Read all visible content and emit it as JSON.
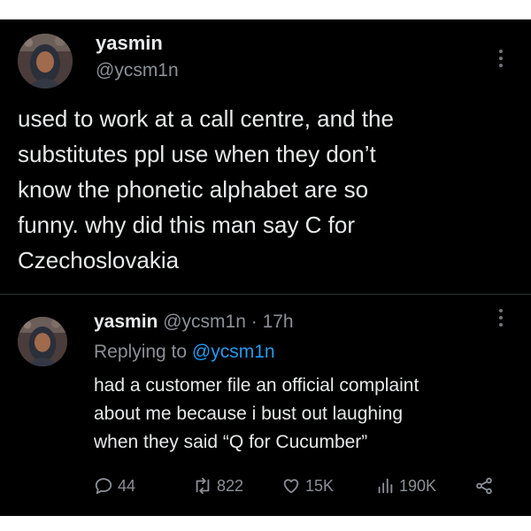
{
  "tweet": {
    "name": "yasmin",
    "handle": "@ycsm1n",
    "text": "used to work at a call centre, and the\nsubstitutes ppl use when they don’t\nknow the phonetic alphabet are so\nfunny. why did this man say C for\nCzechoslovakia"
  },
  "reply": {
    "name": "yasmin",
    "handle": "@ycsm1n",
    "separator": "·",
    "time": "17h",
    "replying_to_label": "Replying to",
    "replying_to_handle": "@ycsm1n",
    "text": "had a customer file an official complaint\nabout me because i bust out laughing\nwhen they said “Q for Cucumber”",
    "stats": {
      "replies": "44",
      "retweets": "822",
      "likes": "15K",
      "views": "190K"
    }
  },
  "icons": [
    "more-icon",
    "reply-icon",
    "retweet-icon",
    "like-icon",
    "views-icon",
    "share-icon"
  ],
  "colors": {
    "background": "#000000",
    "text": "#e7e9ea",
    "secondary": "#8b9096",
    "link": "#1d9bf0",
    "divider": "#2f3336"
  }
}
